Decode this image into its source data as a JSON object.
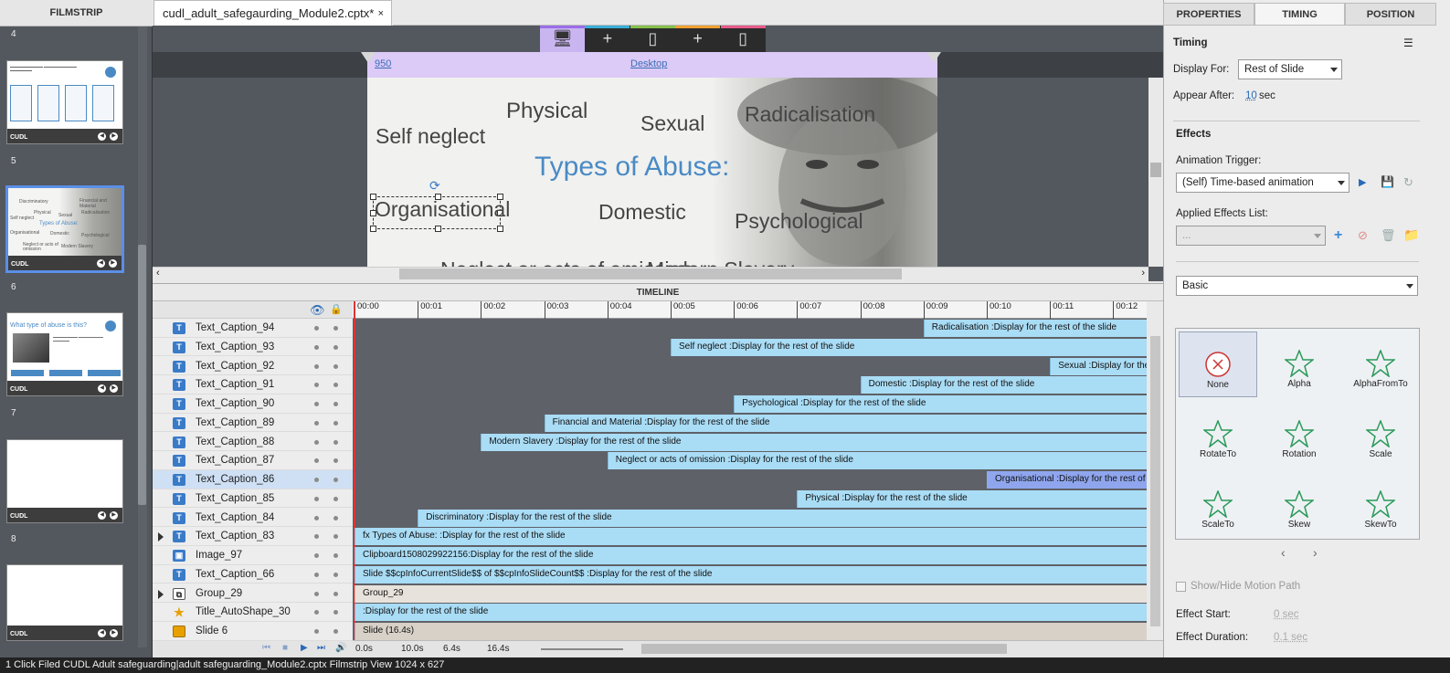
{
  "filmstrip": {
    "title": "FILMSTRIP",
    "slides": [
      "4",
      "5",
      "6",
      "7",
      "8"
    ],
    "thumb_logo": "CUDL",
    "thumb6_title": "What type of abuse is this?",
    "thumb5": {
      "title": "Types of Abuse:",
      "words": [
        "Discriminatory",
        "Financial and Material",
        "Physical",
        "Sexual",
        "Radicalisation",
        "Self neglect",
        "Organisational",
        "Domestic",
        "Psychological",
        "Neglect or acts of omission",
        "Modern Slavery"
      ]
    }
  },
  "document_tab": {
    "label": "cudl_adult_safegaurding_Module2.cptx*",
    "close": "×"
  },
  "devices": [
    {
      "icon": "desktop-icon",
      "glyph": "🖥"
    },
    {
      "icon": "plus-icon",
      "glyph": "+"
    },
    {
      "icon": "tablet-icon",
      "glyph": "▯"
    },
    {
      "icon": "plus-icon",
      "glyph": "+"
    },
    {
      "icon": "phone-icon",
      "glyph": "▯"
    }
  ],
  "device_colors": [
    "#9b6ee8",
    "#3aaed8",
    "#86c04b",
    "#f0a030",
    "#e85a8a"
  ],
  "breakpoint": {
    "width": "950",
    "name": "Desktop"
  },
  "canvas": {
    "words": [
      "Physical",
      "Sexual",
      "Radicalisation",
      "Self neglect",
      "Types of Abuse:",
      "Organisational",
      "Domestic",
      "Psychological",
      "Neglect or acts of omission",
      "Modern Slavery"
    ],
    "title_color": "#4a8ac4"
  },
  "timeline": {
    "header": "TIMELINE",
    "ticks": [
      "00:00",
      "00:01",
      "00:02",
      "00:03",
      "00:04",
      "00:05",
      "00:06",
      "00:07",
      "00:08",
      "00:09",
      "00:10",
      "00:11",
      "00:12"
    ],
    "rows": [
      {
        "name": "Text_Caption_94",
        "bar": "Radicalisation  :Display for the rest of the slide",
        "start": 9.0
      },
      {
        "name": "Text_Caption_93",
        "bar": "Self neglect :Display for the rest of the slide",
        "start": 5.0
      },
      {
        "name": "Text_Caption_92",
        "bar": "Sexual :Display for the re",
        "start": 11.0
      },
      {
        "name": "Text_Caption_91",
        "bar": "Domestic :Display for the rest of the slide",
        "start": 8.0
      },
      {
        "name": "Text_Caption_90",
        "bar": "Psychological  :Display for the rest of the slide",
        "start": 6.0
      },
      {
        "name": "Text_Caption_89",
        "bar": "Financial and Material :Display for the rest of the slide",
        "start": 3.0
      },
      {
        "name": "Text_Caption_88",
        "bar": "Modern Slavery :Display for the rest of the slide",
        "start": 2.0
      },
      {
        "name": "Text_Caption_87",
        "bar": "Neglect or acts of omission  :Display for the rest of the slide",
        "start": 4.0
      },
      {
        "name": "Text_Caption_86",
        "bar": "Organisational :Display for the rest of the",
        "start": 10.0,
        "selected": true
      },
      {
        "name": "Text_Caption_85",
        "bar": "Physical  :Display for the rest of the slide",
        "start": 7.0
      },
      {
        "name": "Text_Caption_84",
        "bar": "Discriminatory :Display for the rest of the slide",
        "start": 1.0
      },
      {
        "name": "Text_Caption_83",
        "bar": "fx  Types of Abuse: :Display for the rest of the slide",
        "start": 0,
        "expand": true
      },
      {
        "name": "Image_97",
        "bar": "Clipboard1508029922156:Display for the rest of the slide",
        "start": 0
      },
      {
        "name": "Text_Caption_66",
        "bar": "Slide $$cpInfoCurrentSlide$$ of $$cpInfoSlideCount$$ :Display for the rest of the slide",
        "start": 0
      },
      {
        "name": "Group_29",
        "bar": "Group_29",
        "start": 0,
        "expand": true,
        "style": "grey"
      },
      {
        "name": "Title_AutoShape_30",
        "bar": " :Display for the rest of the slide",
        "start": 0
      },
      {
        "name": "Slide 6",
        "bar": "Slide (16.4s)",
        "start": 0,
        "style": "tan"
      }
    ],
    "bottom": {
      "t0": "0.0s",
      "t1": "10.0s",
      "t2": "6.4s",
      "t3": "16.4s"
    }
  },
  "props": {
    "tabs": [
      "PROPERTIES",
      "TIMING",
      "POSITION"
    ],
    "timing_title": "Timing",
    "display_for_label": "Display For:",
    "display_for_value": "Rest of Slide",
    "appear_after_label": "Appear After:",
    "appear_after_value": "10",
    "appear_after_unit": "sec",
    "effects_title": "Effects",
    "anim_trigger_label": "Animation Trigger:",
    "anim_trigger_value": "(Self) Time-based animation",
    "applied_label": "Applied Effects List:",
    "applied_value": "...",
    "category_value": "Basic",
    "effects": [
      "None",
      "Alpha",
      "AlphaFromTo",
      "RotateTo",
      "Rotation",
      "Scale",
      "ScaleTo",
      "Skew",
      "SkewTo"
    ],
    "motion_path": "Show/Hide Motion Path",
    "effect_start_label": "Effect Start:",
    "effect_start_value": "0 sec",
    "effect_duration_label": "Effect Duration:",
    "effect_duration_value": "0.1 sec"
  },
  "status": {
    "text": "1 Click Filed CUDL Adult safeguarding|adult safeguarding_Module2.cptx                                                                                                                                                                                                                                              Filmstrip View           1024 x 627"
  }
}
